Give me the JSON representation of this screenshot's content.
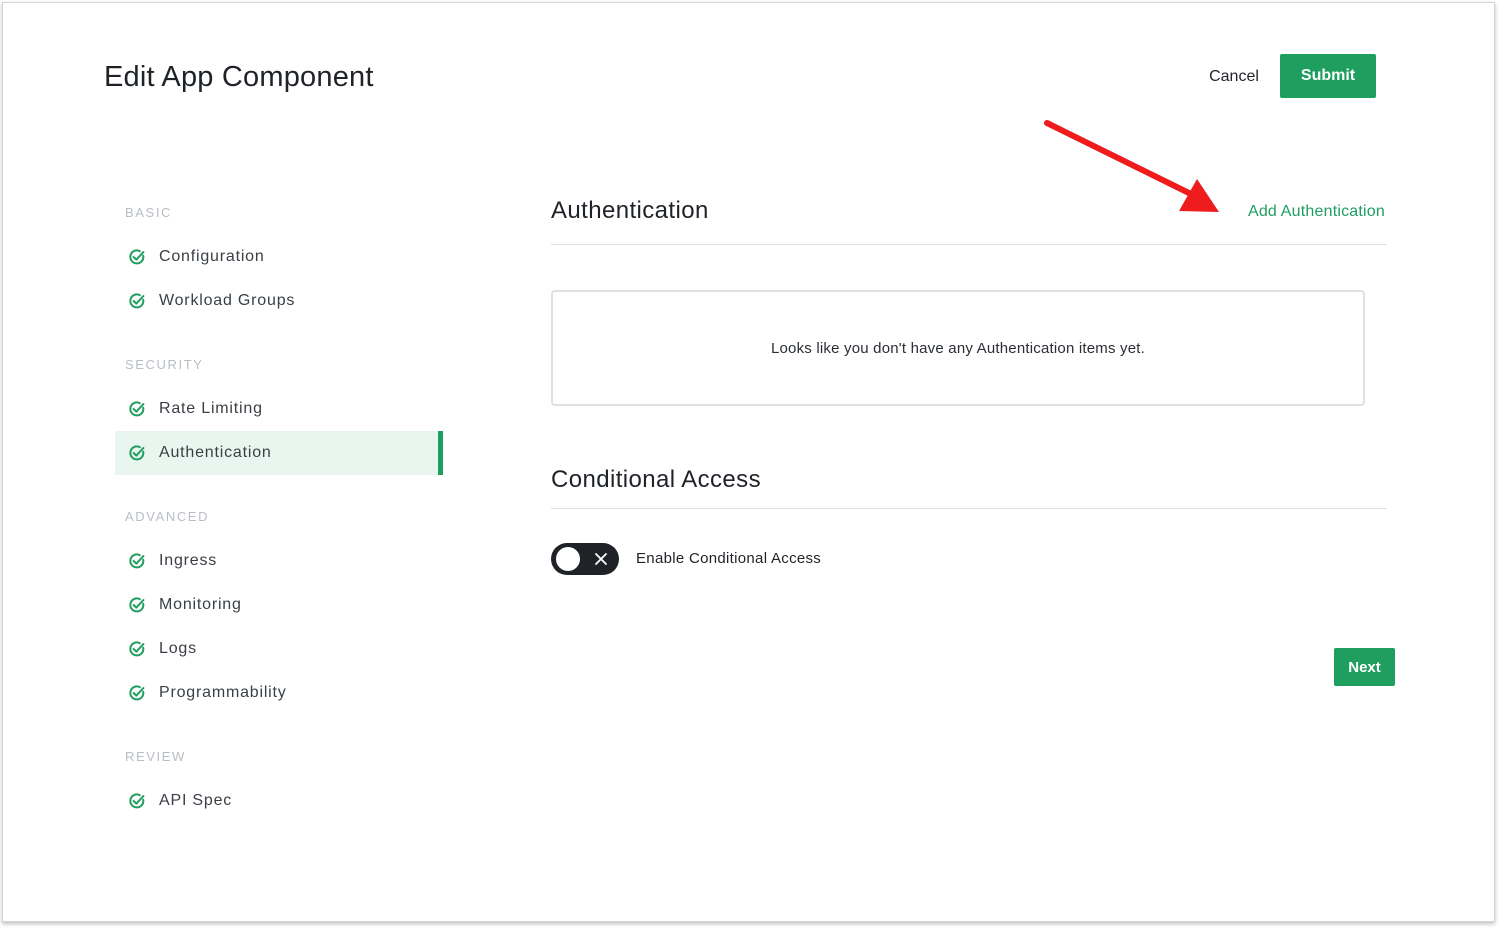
{
  "header": {
    "title": "Edit App Component",
    "cancel_label": "Cancel",
    "submit_label": "Submit"
  },
  "sidebar": {
    "sections": [
      {
        "label": "BASIC",
        "items": [
          {
            "label": "Configuration",
            "icon": "check-circle-icon"
          },
          {
            "label": "Workload Groups",
            "icon": "check-circle-icon"
          }
        ]
      },
      {
        "label": "SECURITY",
        "items": [
          {
            "label": "Rate Limiting",
            "icon": "check-circle-icon"
          },
          {
            "label": "Authentication",
            "icon": "check-circle-icon",
            "active": true
          }
        ]
      },
      {
        "label": "ADVANCED",
        "items": [
          {
            "label": "Ingress",
            "icon": "check-circle-icon"
          },
          {
            "label": "Monitoring",
            "icon": "check-circle-icon"
          },
          {
            "label": "Logs",
            "icon": "check-circle-icon"
          },
          {
            "label": "Programmability",
            "icon": "check-circle-icon"
          }
        ]
      },
      {
        "label": "REVIEW",
        "items": [
          {
            "label": "API Spec",
            "icon": "check-circle-icon"
          }
        ]
      }
    ]
  },
  "main": {
    "authentication": {
      "heading": "Authentication",
      "add_link": "Add Authentication",
      "empty_message": "Looks like you don't have any Authentication items yet."
    },
    "conditional_access": {
      "heading": "Conditional Access",
      "toggle_label": "Enable Conditional Access",
      "toggle_enabled": false
    },
    "next_label": "Next"
  },
  "colors": {
    "accent": "#1e9e5f",
    "active_bg": "#e9f6ef",
    "toggle_bg": "#1f2328",
    "annotation_arrow": "#ee1c1c"
  }
}
